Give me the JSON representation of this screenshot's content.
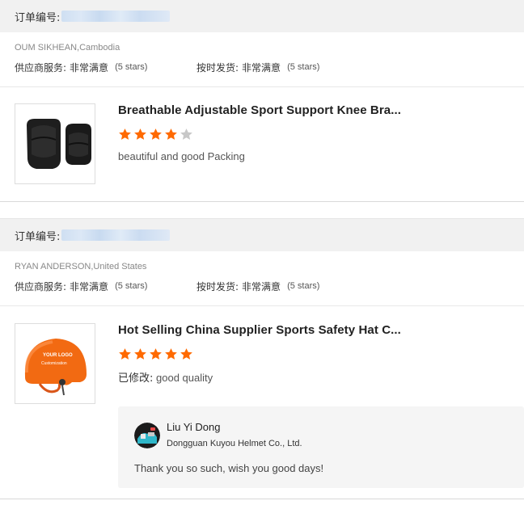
{
  "orders": [
    {
      "order_label": "订单编号:",
      "buyer": "OUM SIKHEAN,Cambodia",
      "supplier_service_label": "供应商服务:",
      "supplier_service_value": "非常满意",
      "supplier_service_stars": "(5 stars)",
      "ontime_label": "按时发货:",
      "ontime_value": "非常满意",
      "ontime_stars": "(5 stars)",
      "product_title": "Breathable Adjustable Sport Support Knee Bra...",
      "product_image_icon": "knee-pad-image",
      "rating": 4,
      "review_prefix": "",
      "review": "beautiful and good Packing"
    },
    {
      "order_label": "订单编号:",
      "buyer": "RYAN ANDERSON,United States",
      "supplier_service_label": "供应商服务:",
      "supplier_service_value": "非常满意",
      "supplier_service_stars": "(5 stars)",
      "ontime_label": "按时发货:",
      "ontime_value": "非常满意",
      "ontime_stars": "(5 stars)",
      "product_title": "Hot Selling China Supplier Sports Safety Hat C...",
      "product_image_icon": "helmet-image",
      "helmet_text_1": "YOUR LOGO",
      "helmet_text_2": "Customization",
      "rating": 5,
      "review_prefix": "已修改:",
      "review": " good quality",
      "reply": {
        "name": "Liu Yi Dong",
        "company": "Dongguan Kuyou Helmet Co., Ltd.",
        "text": "Thank you so such, wish you good days!"
      }
    }
  ],
  "colors": {
    "star_filled": "#ff6a00",
    "star_empty": "#c8c8c8",
    "header_bg": "#f1f1f1",
    "reply_bg": "#f5f5f5"
  }
}
